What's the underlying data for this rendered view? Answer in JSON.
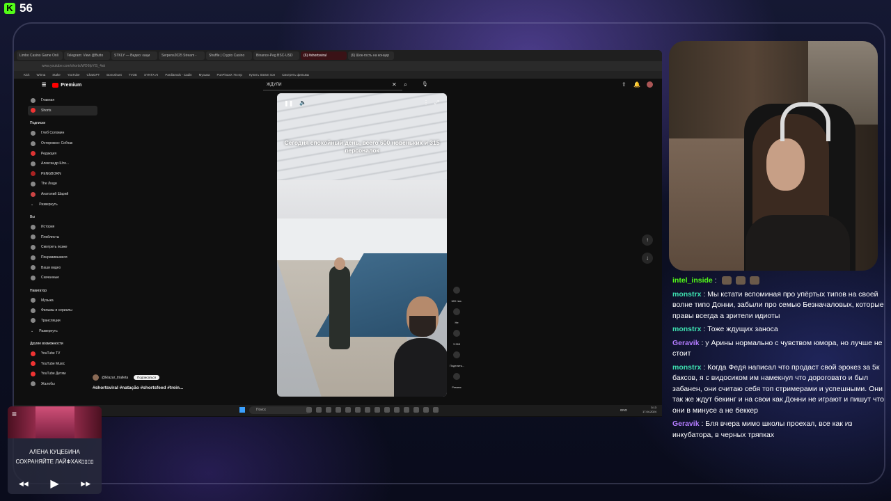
{
  "stream": {
    "viewer_count": "56",
    "platform_icon": "kick-logo"
  },
  "browser": {
    "tabs": [
      "Limbo Casino Game Onli",
      "Telegram: View @Butto",
      "STKLY — Видео: каци",
      "Serpens2025 Stream -",
      "Shuffle | Crypto Casino",
      "Binance-Peg BSC-USD",
      "(6) #shortsviral",
      "(6) Шок-гость на концер"
    ],
    "address": "www.youtube.com/shorts/WO6fpYlS_4ak",
    "bookmarks": [
      "Kick",
      "Winna",
      "Stake",
      "YouTube",
      "ChatGPT",
      "Bonushunt",
      "TVOE",
      "SYNTX AI",
      "Pardiamals - Cadin",
      "Музыка",
      "PunPinaxX 76 игр",
      "Купить Steam пон",
      "Смотреть фильмы"
    ]
  },
  "youtube": {
    "logo_text": "Premium",
    "search_value": "ЖДУЛИ",
    "sidebar": {
      "main": [
        "Главная",
        "Shorts"
      ],
      "subscriptions_title": "Подписки",
      "subscriptions": [
        "Глеб Соломин",
        "Осторожно: Собчак",
        "Редакция",
        "Александр Ште...",
        "PENGBORN",
        "The Люди",
        "Анатолий Шарий",
        "Развернуть"
      ],
      "you_title": "Вы",
      "you": [
        "История",
        "Плейлисты",
        "Смотреть позже",
        "Понравившиеся",
        "Ваши видео",
        "Скачанные"
      ],
      "nav_title": "Навигатор",
      "nav": [
        "Музыка",
        "Фильмы и сериалы",
        "Трансляции",
        "Развернуть"
      ],
      "other_title": "Другие возможности",
      "other": [
        "YouTube TV",
        "YouTube Music",
        "YouTube Детям",
        "Жалобы"
      ]
    },
    "video": {
      "caption": "Сегодня спокойный день, всего 600 новеньких и 315 персоналок",
      "channel": "@Elazar_trialleta",
      "subscribe": "Подписаться",
      "tags": "#shortsviral #natação #shortsfeed #trein...",
      "likes": "169 тыс.",
      "dislike_label": "Не",
      "comments": "3 265",
      "share": "Поделить...",
      "remix": "Ремикс"
    }
  },
  "taskbar": {
    "search_placeholder": "Поиск",
    "lang": "ENG",
    "time": "3:13",
    "date": "17.04.2024"
  },
  "chat": [
    {
      "user": "intel_inside",
      "color": "#53fc18",
      "text": "",
      "emotes": 3
    },
    {
      "user": "monstrx",
      "color": "#3de0b0",
      "text": "Мы кстати вспоминая про упёртых типов на своей волне типо Донни, забыли про семью Безначаловых, которые правы всегда а зрители идиоты"
    },
    {
      "user": "monstrx",
      "color": "#3de0b0",
      "text": "Тоже ждущих заноса"
    },
    {
      "user": "Geravik",
      "color": "#b47cff",
      "text": "у Арины нормально с чувством юмора, но лучше не стоит"
    },
    {
      "user": "monstrx",
      "color": "#3de0b0",
      "text": "Когда Федя написал что продаст свой эрокез за 5к баксов, я с видосиком им намекнул что дороговато и был забанен, они считаю себя топ стримерами и успешными. Они так же ждут бекинг и на свои как Донни не играют и пишут что они в минусе а не беккер"
    },
    {
      "user": "Geravik",
      "color": "#b47cff",
      "text": "Бля вчера мимо школы проехал, все как из инкубатора, в черных тряпках"
    }
  ],
  "music": {
    "artist": "АЛЁНА КУЦЕБИНА",
    "song": "СОХРАНЯЙТЕ ЛАЙФХАК▯▯▯▯"
  }
}
